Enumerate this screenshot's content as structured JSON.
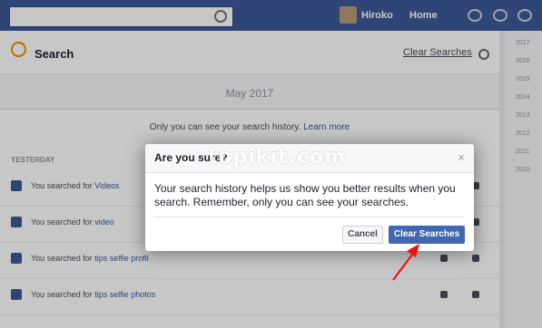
{
  "topbar": {
    "user_name": "Hiroko",
    "home_label": "Home"
  },
  "search_panel": {
    "title": "Search",
    "clear_link": "Clear Searches"
  },
  "month_label": "May 2017",
  "privacy_note": "Only you can see your search history.",
  "privacy_link": "Learn more",
  "section_label": "YESTERDAY",
  "history_rows": [
    {
      "prefix": "You searched for",
      "term": "Videos"
    },
    {
      "prefix": "You searched for",
      "term": "video"
    },
    {
      "prefix": "You searched for",
      "term": "tips selfie profil"
    },
    {
      "prefix": "You searched for",
      "term": "tips selfie photos"
    }
  ],
  "right_column_ticks": [
    "2017",
    "2016",
    "2015",
    "2014",
    "2013",
    "2012",
    "2011",
    "2010"
  ],
  "dialog": {
    "title": "Are you sure?",
    "close_glyph": "×",
    "message": "Your search history helps us show you better results when you search. Remember, only you can see your searches.",
    "cancel_label": "Cancel",
    "confirm_label": "Clear Searches"
  },
  "watermark": "topikit.com",
  "colors": {
    "brand_blue": "#3b5998",
    "confirm_button": "#4267b2",
    "arrow": "#ee1111"
  }
}
